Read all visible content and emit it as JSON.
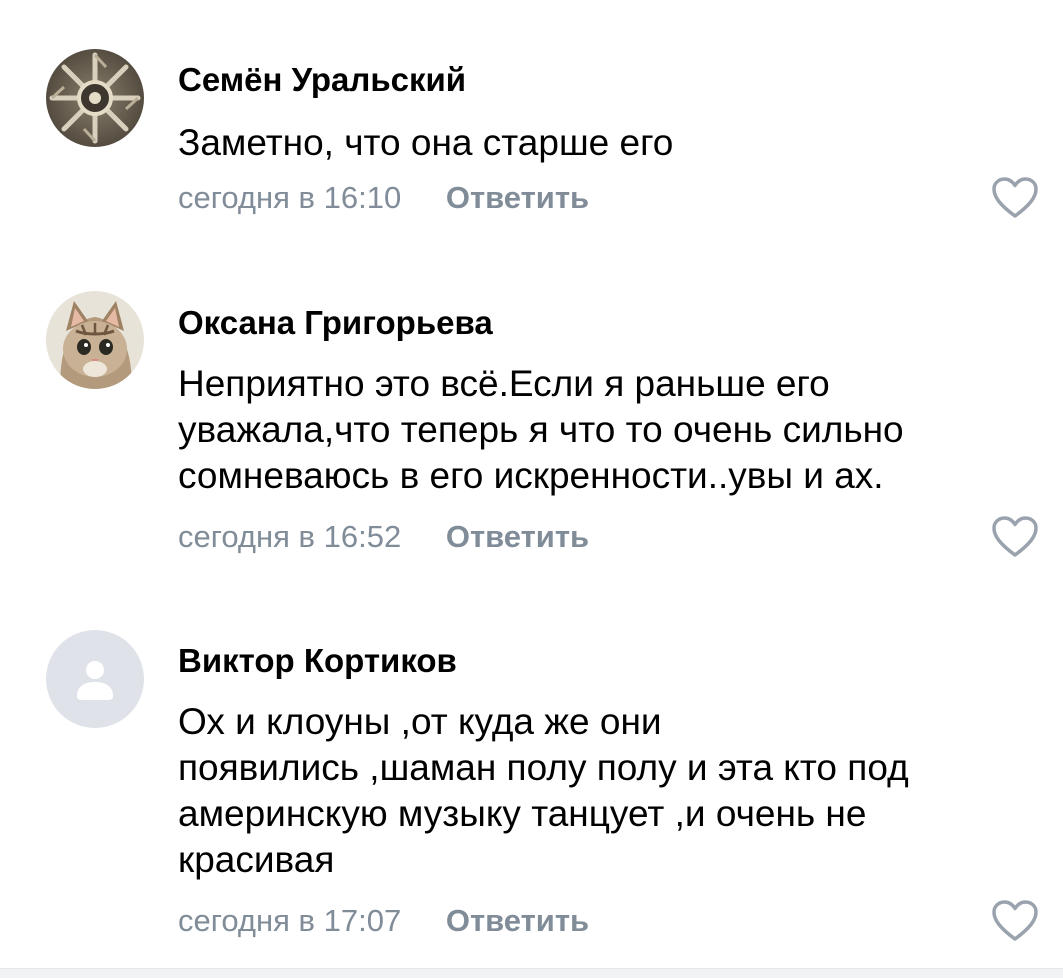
{
  "comments": [
    {
      "author": "Семён Уральский",
      "lines": [
        "Заметно, что она старше его"
      ],
      "time": "сегодня в 16:10",
      "reply_label": "Ответить",
      "avatar_icon": "ornament-avatar-icon"
    },
    {
      "author": "Оксана Григорьева",
      "lines": [
        "Неприятно это всё.Если я раньше его",
        "уважала,что теперь я что то очень сильно",
        "сомневаюсь в его искренности..увы и ах."
      ],
      "time": "сегодня в 16:52",
      "reply_label": "Ответить",
      "avatar_icon": "kitten-avatar-icon"
    },
    {
      "author": "Виктор Кортиков",
      "lines": [
        "Ох и клоуны ,от куда же они",
        "появились ,шаман полу полу и эта кто под",
        "америнскую музыку танцует ,и очень не",
        "красивая"
      ],
      "time": "сегодня в 17:07",
      "reply_label": "Ответить",
      "avatar_icon": "default-user-avatar-icon"
    }
  ],
  "colors": {
    "text": "#000000",
    "meta": "#818c99",
    "like_outline": "#99a2ad",
    "placeholder_avatar_bg": "#dfe3e9",
    "placeholder_avatar_fg": "#ffffff"
  },
  "icons": {
    "like": "heart-outline-icon"
  }
}
